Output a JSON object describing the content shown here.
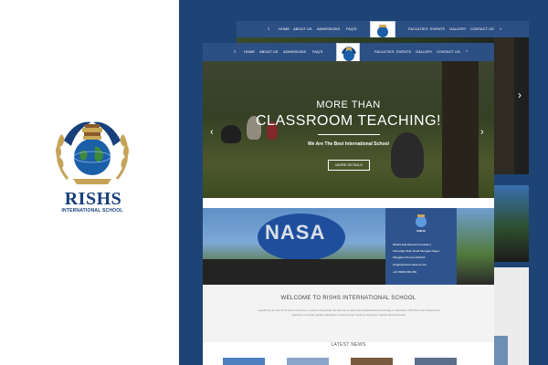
{
  "brand": {
    "name": "RISHS",
    "subtitle": "INTERNATIONAL SCHOOL"
  },
  "nav": {
    "items_left": [
      "HOME",
      "ABOUT US",
      "ADMISSIONS",
      "FAQ'S"
    ],
    "items_right": [
      "FACULTIES",
      "EVENTS",
      "GALLERY",
      "CONTACT US"
    ],
    "logo_text": "RISHS"
  },
  "hero": {
    "line1": "MORE THAN",
    "line2": "CLASSROOM TEACHING!",
    "tagline": "We Are The Best International School",
    "button": "MORE DETAILS"
  },
  "photo": {
    "banner_text": "NASA"
  },
  "info": {
    "logo_text": "RISHS",
    "rows": [
      "RISHS Educational Foundation,",
      "Kamarajar Main Road Murugan Nagar,",
      "Mangadu Chennai 600122",
      "info@rishsinternational.com",
      "+91 99999 999 999"
    ]
  },
  "welcome": {
    "title": "WELCOME TO RISHS INTERNATIONAL SCHOOL",
    "text": "Launching the first of its kind in Chennai, a school integrating the best up-to-date and sophisticated technology in education. RISHS is committed at an objective to provide quality education to both young minds to compete in global demand future."
  },
  "news": {
    "title": "LATEST NEWS"
  },
  "colors": {
    "brand_blue": "#1d4474",
    "nav_blue": "#2c4f84",
    "info_blue": "#2f548d",
    "brand_text": "#173f7a"
  },
  "icons": {
    "search": "search-icon",
    "menu": "hamburger-icon",
    "prev": "chevron-left-icon",
    "next": "chevron-right-icon"
  }
}
